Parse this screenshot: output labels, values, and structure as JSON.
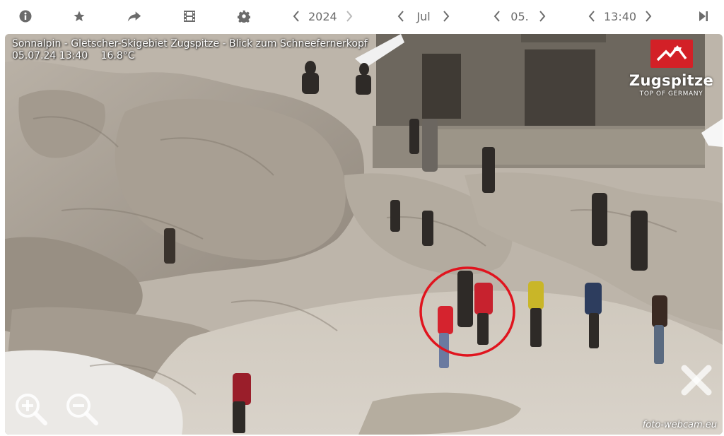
{
  "toolbar": {
    "icons": [
      "info-icon",
      "star-icon",
      "share-icon",
      "film-icon",
      "gear-icon",
      "skip-end-icon"
    ],
    "year": "2024",
    "month": "Jul",
    "day": "05.",
    "time": "13:40"
  },
  "image": {
    "title": "Sonnalpin - Gletscher-Skigebiet Zugspitze - Blick zum Schneefernerkopf",
    "datetime": "05.07.24 13:40",
    "temperature": "16.8°C",
    "brand_name": "Zugspitze",
    "brand_tagline": "TOP OF GERMANY",
    "watermark": "foto-webcam.eu"
  },
  "colors": {
    "toolbar_icon": "#6b6b6b",
    "brand_red": "#d32027",
    "annotation_circle": "#e0141e"
  }
}
